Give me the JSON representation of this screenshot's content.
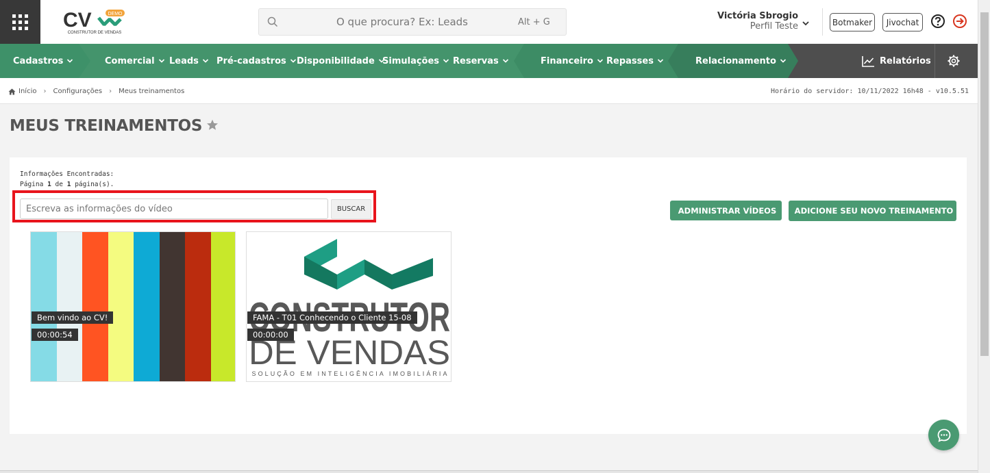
{
  "header": {
    "logo_text": "CV",
    "logo_badge": "DEMO",
    "logo_subtitle": "CONSTRUTOR DE VENDAS",
    "search_placeholder": "O que procura? Ex: Leads",
    "search_shortcut": "Alt + G",
    "user_name": "Victória Sbrogio",
    "user_profile": "Perfil Teste",
    "botmaker_label": "Botmaker",
    "jivochat_label": "Jivochat",
    "icons": [
      "apps-grid-icon",
      "search-icon",
      "chevron-down-icon",
      "help-icon",
      "logout-icon"
    ]
  },
  "nav": {
    "items": [
      {
        "label": "Cadastros"
      },
      {
        "label": "Comercial"
      },
      {
        "label": "Leads"
      },
      {
        "label": "Pré-cadastros"
      },
      {
        "label": "Disponibilidade"
      },
      {
        "label": "Simulações"
      },
      {
        "label": "Reservas"
      },
      {
        "label": "Financeiro"
      },
      {
        "label": "Repasses"
      },
      {
        "label": "Relacionamento"
      }
    ],
    "reports_label": "Relatórios",
    "colors": {
      "green_1": "#3e9169",
      "green_2": "#44946c",
      "green_3": "#3d8c65",
      "green_4": "#377e5c",
      "dark": "#4e4e4e"
    }
  },
  "breadcrumb": {
    "items": [
      "Início",
      "Configurações",
      "Meus treinamentos"
    ],
    "server_time": "Horário do servidor: 10/11/2022 16h48 - v10.5.51"
  },
  "page": {
    "title": "MEUS TREINAMENTOS",
    "info_line1": "Informações Encontradas:",
    "info_page_prefix": "Página",
    "info_page_current": "1",
    "info_page_mid": "de",
    "info_page_total": "1",
    "info_page_suffix": "página(s).",
    "search_placeholder": "Escreva as informações do vídeo",
    "search_button": "BUSCAR",
    "admin_button": "ADMINISTRAR VÍDEOS",
    "add_button": "ADICIONE SEU NOVO TREINAMENTO",
    "accent_color": "#4a9a72",
    "highlight_color": "#e8141c"
  },
  "videos": [
    {
      "title": "Bem vindo ao CV!",
      "duration": "00:00:54",
      "bar_colors": [
        "#85dbe6",
        "#e8f2f3",
        "#ff5422",
        "#f4fb80",
        "#0eaad5",
        "#413531",
        "#bb2c0e",
        "#c8e82a"
      ]
    },
    {
      "title": "FAMA - T01 Conhecendo o Cliente 15-08",
      "duration": "00:00:00",
      "logo_line1": "CONSTRUTOR",
      "logo_line2": "DE VENDAS",
      "logo_tagline": "SOLUÇÃO EM INTELIGÊNCIA IMOBILIÁRIA"
    }
  ]
}
